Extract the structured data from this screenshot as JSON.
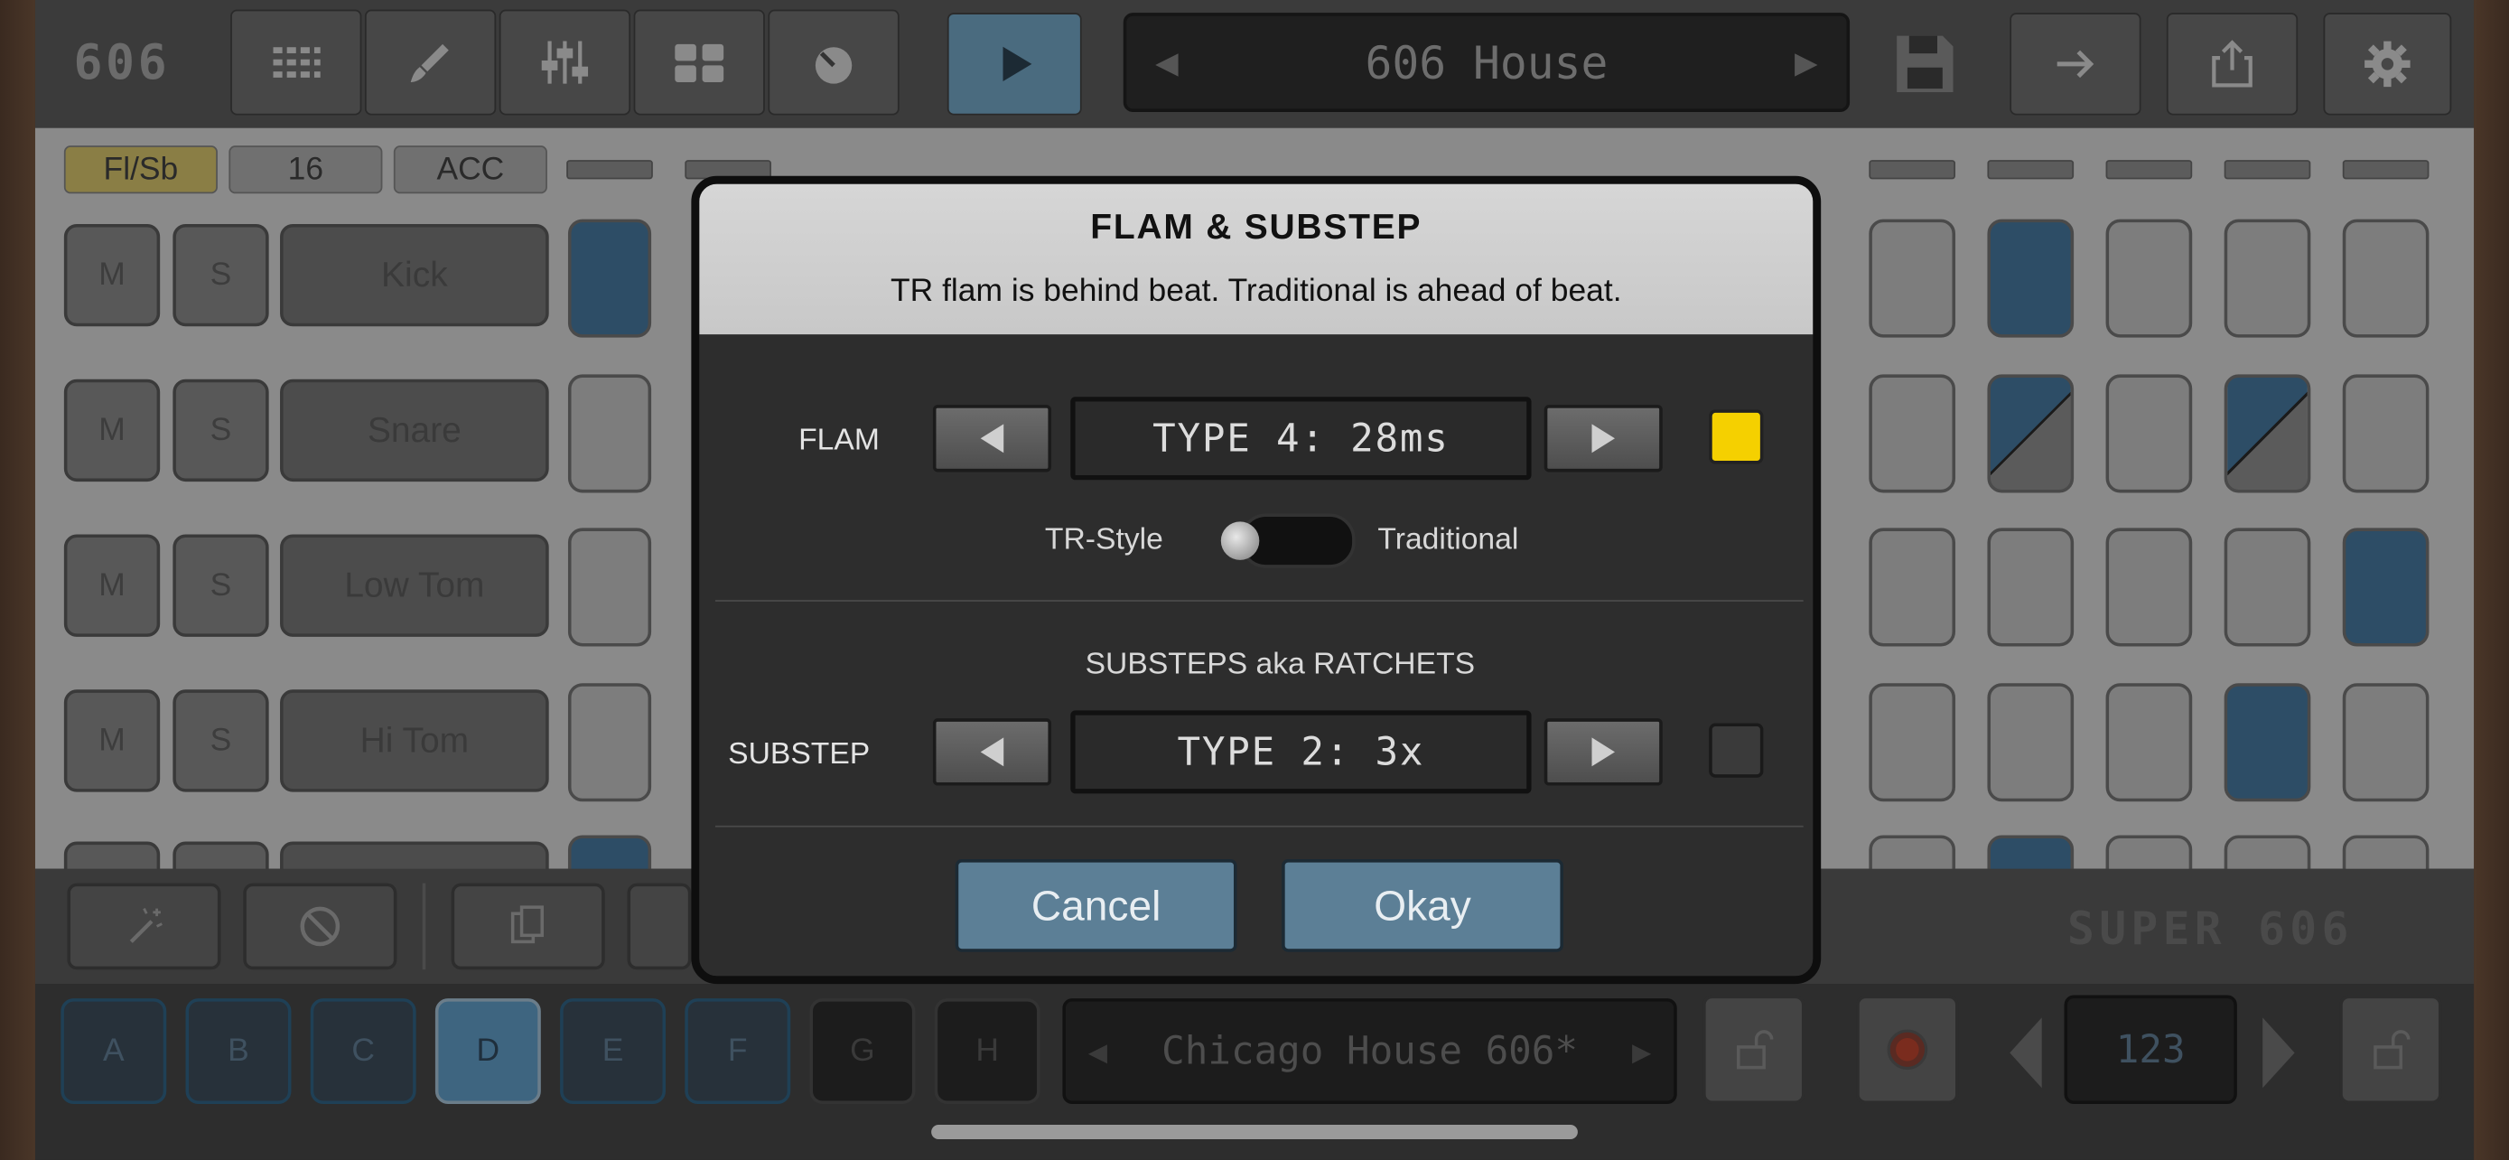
{
  "header": {
    "logo": "606",
    "pattern_name": "606 House"
  },
  "sequencer": {
    "chips": [
      "Fl/Sb",
      "16",
      "ACC"
    ],
    "tracks": [
      {
        "mute": "M",
        "solo": "S",
        "name": "Kick"
      },
      {
        "mute": "M",
        "solo": "S",
        "name": "Snare"
      },
      {
        "mute": "M",
        "solo": "S",
        "name": "Low Tom"
      },
      {
        "mute": "M",
        "solo": "S",
        "name": "Hi Tom"
      }
    ]
  },
  "footer": {
    "brand": "SUPER 606",
    "patterns": [
      "A",
      "B",
      "C",
      "D",
      "E",
      "F",
      "G",
      "H"
    ],
    "selected_pattern": "D",
    "song_name": "Chicago House 606*",
    "tempo": "123"
  },
  "dialog": {
    "title": "FLAM & SUBSTEP",
    "subtitle": "TR flam is behind beat. Traditional is ahead of beat.",
    "flam": {
      "label": "FLAM",
      "value": "TYPE 4: 28ms",
      "enabled": true,
      "indicator_color": "#f5d000"
    },
    "toggle": {
      "left_label": "TR-Style",
      "right_label": "Traditional",
      "state": "TR-Style"
    },
    "substeps_heading": "SUBSTEPS aka RATCHETS",
    "substep": {
      "label": "SUBSTEP",
      "value": "TYPE 2: 3x",
      "enabled": false
    },
    "cancel_label": "Cancel",
    "okay_label": "Okay"
  },
  "colors": {
    "accent_blue": "#5c7f96",
    "step_on": "#2d4d66",
    "flam_indicator": "#f5d000"
  }
}
